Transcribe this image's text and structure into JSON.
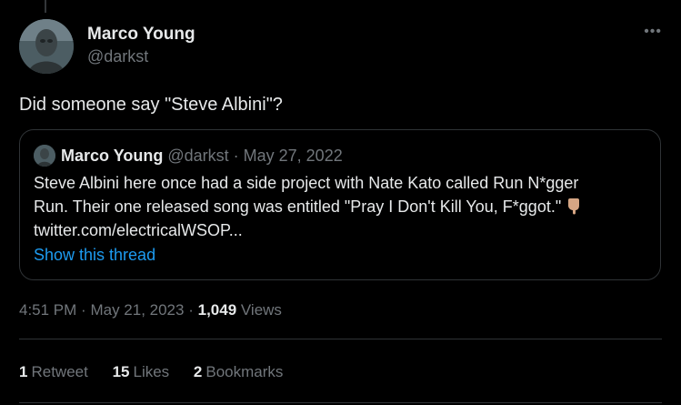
{
  "author": {
    "name": "Marco Young",
    "handle": "@darkst"
  },
  "tweet": {
    "text": "Did someone say \"Steve Albini\"?"
  },
  "quote": {
    "name": "Marco Young",
    "handle": "@darkst",
    "separator": "·",
    "date": "May 27, 2022",
    "line1": "Steve Albini here once had a side project with Nate Kato called Run N*gger",
    "line2": "Run. Their one released song was entitled \"Pray I Don't Kill You, F*ggot.\"",
    "line3": "twitter.com/electricalWSOP...",
    "emoji": "backhand-index-pointing-down",
    "show_thread": "Show this thread"
  },
  "meta": {
    "time": "4:51 PM",
    "sep": "·",
    "date": "May 21, 2023",
    "sep2": "·",
    "views_count": "1,049",
    "views_label": "Views"
  },
  "stats": {
    "retweets": {
      "count": "1",
      "label": "Retweet"
    },
    "likes": {
      "count": "15",
      "label": "Likes"
    },
    "bookmarks": {
      "count": "2",
      "label": "Bookmarks"
    }
  },
  "icons": {
    "more": "more-horizontal-icon"
  },
  "colors": {
    "background": "#000000",
    "text": "#e7e9ea",
    "secondary": "#71767b",
    "link": "#1d9bf0",
    "border": "#2f3336"
  }
}
